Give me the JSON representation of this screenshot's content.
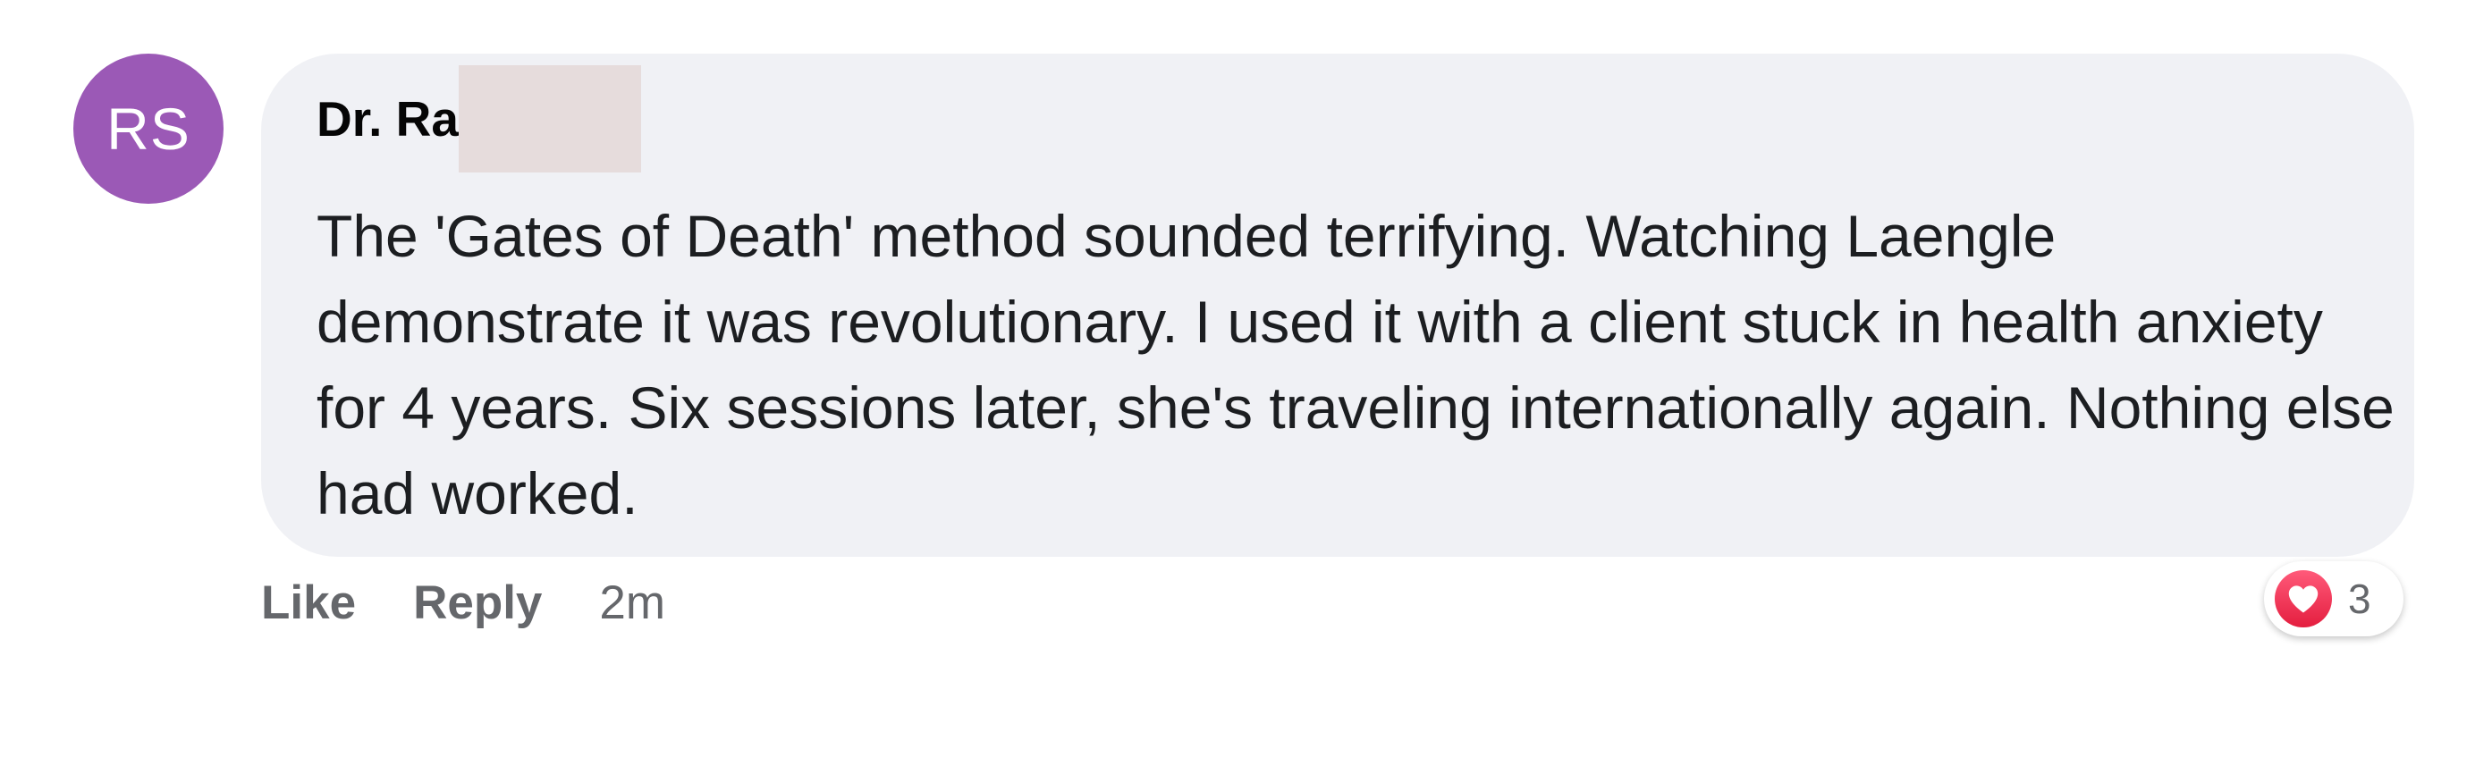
{
  "comment": {
    "avatar_initials": "RS",
    "author_name": "Dr. Ra",
    "text": "The 'Gates of Death' method sounded terrifying. Watching Laengle demonstrate it was revolutionary. I used it with a client stuck in health anxiety for 4 years. Six sessions later, she's traveling internationally again. Nothing else had worked.",
    "actions": {
      "like_label": "Like",
      "reply_label": "Reply",
      "timestamp": "2m"
    },
    "reaction": {
      "icon": "heart-icon",
      "count": "3"
    }
  },
  "colors": {
    "avatar_bg": "#9b59b6",
    "bubble_bg": "#f0f1f5",
    "redaction": "#e6dcdc",
    "heart": "#e41e3f",
    "secondary_text": "#65676b"
  }
}
